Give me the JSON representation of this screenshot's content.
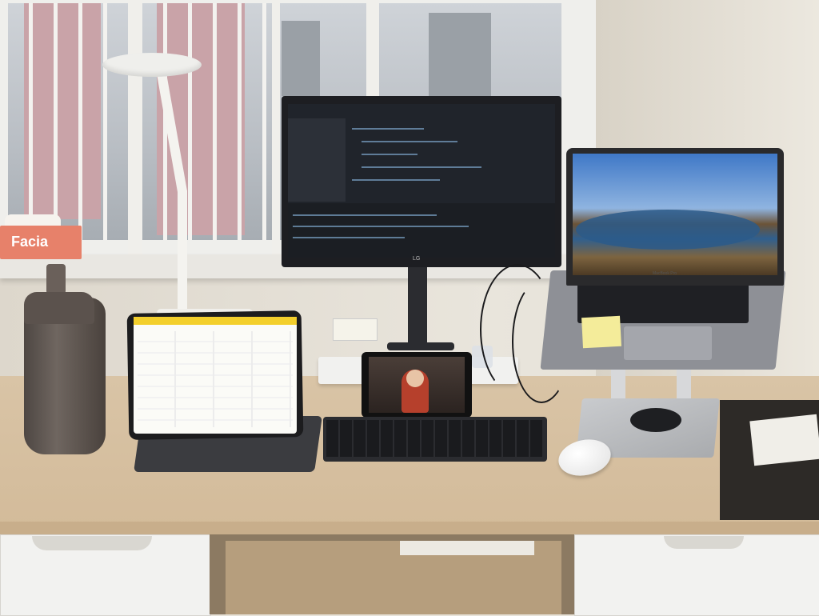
{
  "scene": {
    "tissue_box_brand": "Facia",
    "monitor_brand": "LG",
    "laptop_brand": "MacBook Pro"
  },
  "colors": {
    "desk": "#d6bf9f",
    "wall": "#e7e2d8",
    "tissue_box": "#e7816a",
    "ipad_accent": "#f3cf2c"
  }
}
